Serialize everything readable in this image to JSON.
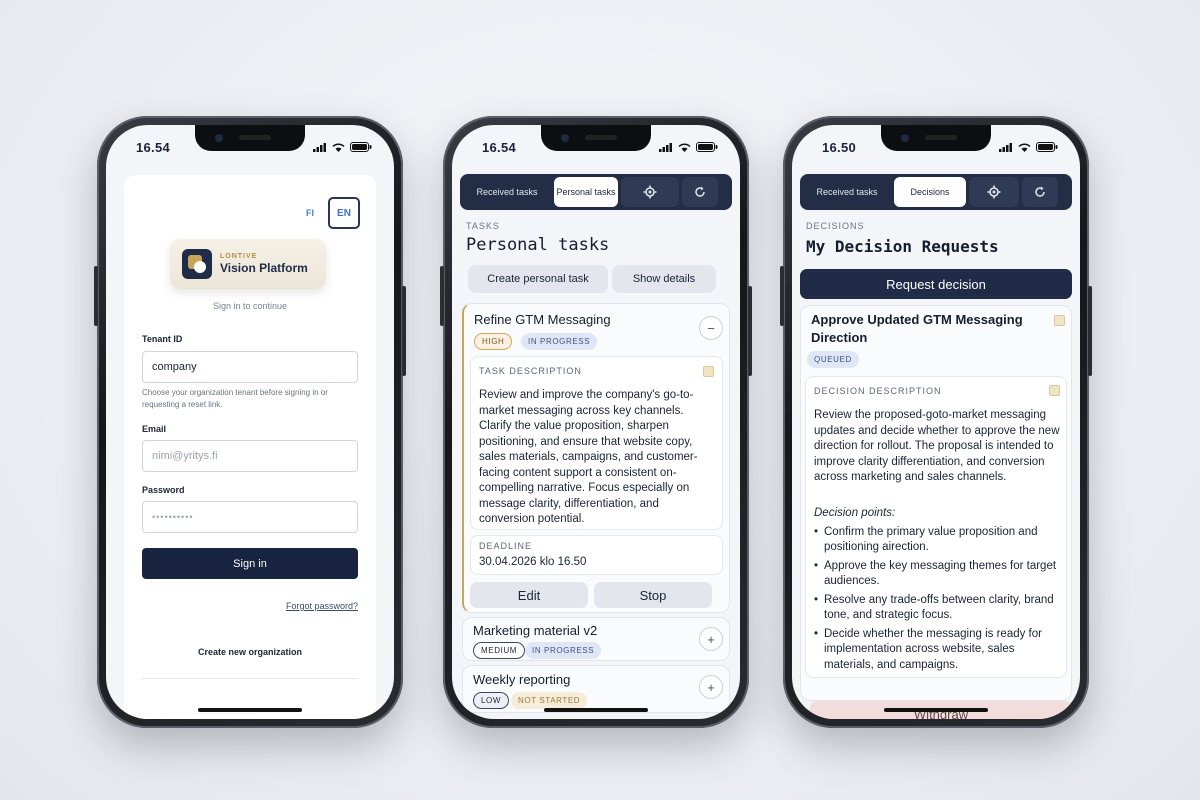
{
  "phone1": {
    "time": "16.54",
    "lang_fi": "FI",
    "lang_en": "EN",
    "brand_small": "LONTIVE",
    "brand_name": "Vision Platform",
    "subtitle": "Sign in to continue",
    "tenant_label": "Tenant ID",
    "tenant_value": "company",
    "tenant_hint": "Choose your organization tenant before signing in or requesting a reset link.",
    "email_label": "Email",
    "email_placeholder": "nimi@yritys.fi",
    "password_label": "Password",
    "password_value": "••••••••••",
    "signin_button": "Sign in",
    "forgot_link": "Forgot password?",
    "create_org": "Create new organization"
  },
  "phone2": {
    "time": "16.54",
    "tabs": {
      "received": "Received tasks",
      "personal": "Personal tasks"
    },
    "section": "TASKS",
    "title": "Personal tasks",
    "create_button": "Create personal task",
    "details_button": "Show details",
    "task1": {
      "title": "Refine GTM Messaging",
      "priority": "HIGH",
      "status": "IN PROGRESS",
      "collapse": "−",
      "desc_label": "TASK DESCRIPTION",
      "description": "Review and improve the company's go-to-market messaging across key channels. Clarify the value proposition, sharpen positioning, and ensure that website copy, sales materials, campaigns, and customer-facing content support a consistent on-compelling narrative. Focus especially on message clarity, differentiation, and conversion potential.",
      "deadline_label": "DEADLINE",
      "deadline": "30.04.2026 klo 16.50",
      "edit": "Edit",
      "stop": "Stop"
    },
    "task2": {
      "title": "Marketing material v2",
      "priority": "MEDIUM",
      "status": "IN PROGRESS",
      "expand": "+"
    },
    "task3": {
      "title": "Weekly reporting",
      "priority": "LOW",
      "status": "NOT STARTED",
      "expand": "+"
    }
  },
  "phone3": {
    "time": "16.50",
    "tabs": {
      "received": "Received tasks",
      "decisions": "Decisions"
    },
    "section": "DECISIONS",
    "title": "My Decision Requests",
    "request_button": "Request decision",
    "decision": {
      "title": "Approve Updated GTM Messaging Direction",
      "status": "QUEUED",
      "desc_label": "DECISION DESCRIPTION",
      "description": "Review the proposed-goto-market messaging updates and decide whether to approve the new direction for rollout. The proposal is intended to improve clarity differentiation, and conversion across marketing and sales channels.",
      "points_label": "Decision points:",
      "points": [
        "Confirm the primary value proposition and positioning airection.",
        "Approve the key messaging themes for target audiences.",
        "Resolve any trade-offs between clarity, brand tone, and strategic focus.",
        "Decide whether the messaging is ready for implementation across website, sales materials, and campaigns."
      ]
    },
    "withdraw_button": "Withdraw"
  }
}
